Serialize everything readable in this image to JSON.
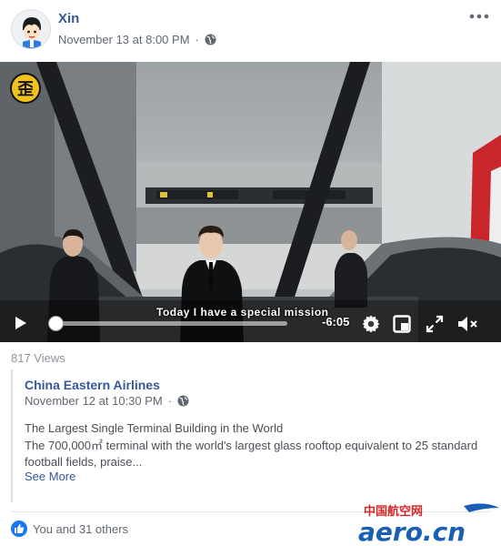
{
  "post": {
    "author": "Xin",
    "timestamp": "November 13 at 8:00 PM",
    "privacy_icon": "globe-icon",
    "more_icon": "more-dots-icon"
  },
  "video": {
    "badge_text": "歪",
    "subtitle": "Today I have a special mission",
    "time_remaining": "-6:05",
    "progress": 0.02,
    "controls": [
      "play-icon",
      "settings-icon",
      "picture-in-picture-icon",
      "fullscreen-icon",
      "mute-icon"
    ]
  },
  "stats": {
    "views": "817 Views"
  },
  "shared": {
    "author": "China Eastern Airlines",
    "timestamp": "November 12 at 10:30 PM",
    "title": "The Largest Single Terminal Building in the World",
    "description": "The 700,000㎡ terminal with the world's largest glass rooftop equivalent to 25 standard football fields, praise...",
    "see_more": "See More"
  },
  "reactions": {
    "text": "You and 31 others"
  },
  "watermark": {
    "chinese": "中国航空网",
    "brand": "aero.cn",
    "colors": {
      "blue": "#1a5fb4",
      "red": "#d62828"
    }
  },
  "colors": {
    "link": "#385898",
    "secondary_text": "#606770",
    "like_blue": "#1877f2"
  }
}
